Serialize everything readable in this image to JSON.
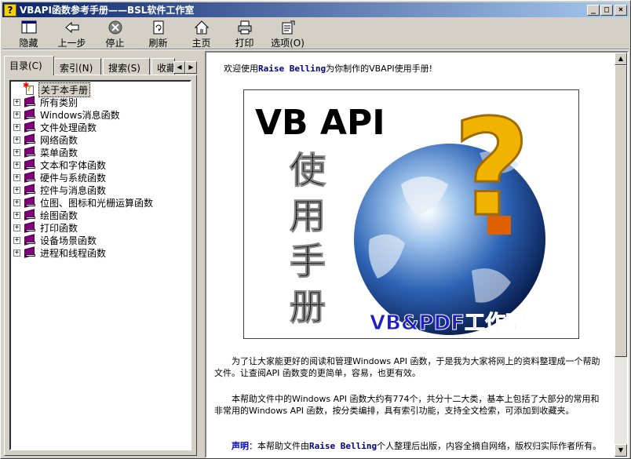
{
  "window": {
    "title": "VBAPI函数参考手册——BSL软件工作室",
    "title_icon": "help-question-icon",
    "buttons": {
      "minimize": "_",
      "maximize": "□",
      "close": "×"
    }
  },
  "toolbar": {
    "items": [
      {
        "label": "隐藏",
        "icon": "hide-pane-icon"
      },
      {
        "label": "上一步",
        "icon": "back-arrow-icon"
      },
      {
        "label": "停止",
        "icon": "stop-icon"
      },
      {
        "label": "刷新",
        "icon": "refresh-icon"
      },
      {
        "label": "主页",
        "icon": "home-icon"
      },
      {
        "label": "打印",
        "icon": "print-icon"
      },
      {
        "label": "选项(O)",
        "icon": "options-icon"
      }
    ]
  },
  "nav": {
    "tabs": [
      {
        "label": "目录(C)",
        "active": true
      },
      {
        "label": "索引(N)",
        "active": false
      },
      {
        "label": "搜索(S)",
        "active": false
      },
      {
        "label": "收藏",
        "active": false
      }
    ],
    "tree": [
      {
        "label": "关于本手册",
        "type": "page",
        "selected": true
      },
      {
        "label": "所有类别",
        "type": "book"
      },
      {
        "label": "Windows消息函数",
        "type": "book"
      },
      {
        "label": "文件处理函数",
        "type": "book"
      },
      {
        "label": "网络函数",
        "type": "book"
      },
      {
        "label": "菜单函数",
        "type": "book"
      },
      {
        "label": "文本和字体函数",
        "type": "book"
      },
      {
        "label": "硬件与系统函数",
        "type": "book"
      },
      {
        "label": "控件与消息函数",
        "type": "book"
      },
      {
        "label": "位图、图标和光栅运算函数",
        "type": "book"
      },
      {
        "label": "绘图函数",
        "type": "book"
      },
      {
        "label": "打印函数",
        "type": "book"
      },
      {
        "label": "设备场景函数",
        "type": "book"
      },
      {
        "label": "进程和线程函数",
        "type": "book"
      }
    ]
  },
  "content": {
    "welcome_prefix": "欢迎使用",
    "welcome_name": "Raise Belling",
    "welcome_suffix": "为你制作的VBAPI使用手册!",
    "banner": {
      "title": "VB API",
      "vertical_chars": [
        "使",
        "用",
        "手",
        "册"
      ],
      "question_mark": "?",
      "studio": "VB&PDF工作室"
    },
    "para1": "为了让大家能更好的阅读和管理Windows API 函数，于是我为大家将网上的资料整理成一个帮助文件。让查阅API 函数变的更简单，容易，也更有效。",
    "para2": "本帮助文件中的Windows API 函数大约有774个，共分十二大类，基本上包括了大部分的常用和非常用的Windows API 函数，按分类编排，具有索引功能，支持全文检索，可添加到收藏夹。",
    "para3_label": "声明",
    "para3_text_a": "：本帮助文件由",
    "para3_name": "Raise Belling",
    "para3_text_b": "个人整理后出版，内容全摘自网络，版权归实际作者所有。"
  }
}
